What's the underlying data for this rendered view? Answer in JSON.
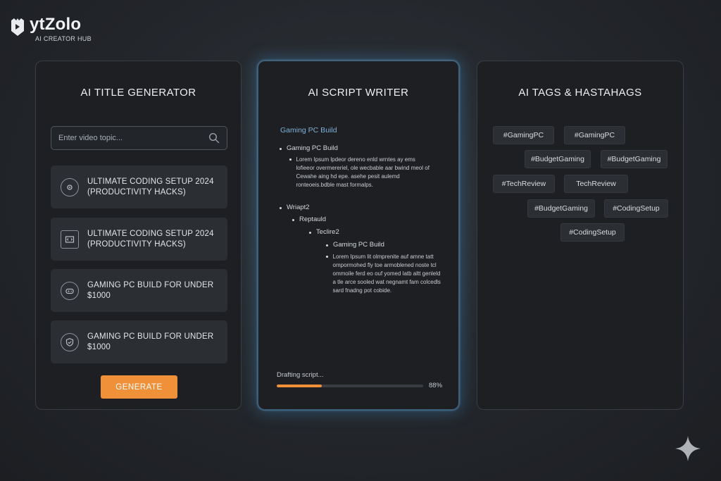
{
  "brand": {
    "name": "ytZolo",
    "subtitle": "AI CREATOR HUB",
    "logo_icon": "shield-logo-icon"
  },
  "title_generator": {
    "heading": "AI TITLE GENERATOR",
    "search_placeholder": "Enter video topic...",
    "search_icon": "search-icon",
    "titles": [
      {
        "text": "ULTIMATE CODING SETUP 2024 (PRODUCTIVITY HACKS)",
        "icon": "settings-circle-icon"
      },
      {
        "text": "ULTIMATE CODING SETUP 2024 (PRODUCTIVITY HACKS)",
        "icon": "monitor-code-icon"
      },
      {
        "text": "GAMING PC BUILD FOR UNDER $1000",
        "icon": "gamepad-icon"
      },
      {
        "text": "GAMING PC BUILD FOR UNDER $1000",
        "icon": "shield-check-icon"
      }
    ],
    "generate_label": "GENERATE",
    "accent_color": "#f0913a"
  },
  "script_writer": {
    "heading": "AI SCRIPT WRITER",
    "script_title": "Gaming PC Build",
    "outline": [
      {
        "text": "Gaming PC Build",
        "level": 1
      },
      {
        "text": "Lorem Ipsum lpdeor dereno enld wrntes ay ems lofieeor overmereriel, ole wecbable aar bwind meol of Cewahe aing hd epe. asehe pesit aulemd ronteoeis.bdble mast formalps.",
        "level": 2
      },
      {
        "text": "Wriapt2",
        "level": 1
      },
      {
        "text": "Reptauld",
        "level": 2
      },
      {
        "text": "Teclire2",
        "level": 3
      },
      {
        "text": "Gaming PC Build",
        "level": 4
      },
      {
        "text": "Lorem Ipsum lit olmprenite auf amne tatt ompormohed fly toe armoblened noste tcl ommoile ferd eo ouf yomed latb altt genleld a tle arce sooled wat negnamt fam colcedls sard fnadng pot cobide.",
        "level": 5
      }
    ],
    "progress_label": "Drafting script...",
    "progress_value": 0.31,
    "progress_text": "88%"
  },
  "tags": {
    "heading": "AI TAGS & HASTAHAGS",
    "items": [
      "#GamingPC",
      "#GamingPC",
      "#BudgetGaming",
      "#BudgetGaming",
      "#TechReview",
      "TechReview",
      "#BudgetGaming",
      "#CodingSetup",
      "#CodingSetup"
    ]
  },
  "corner_icon": "sparkle-icon"
}
